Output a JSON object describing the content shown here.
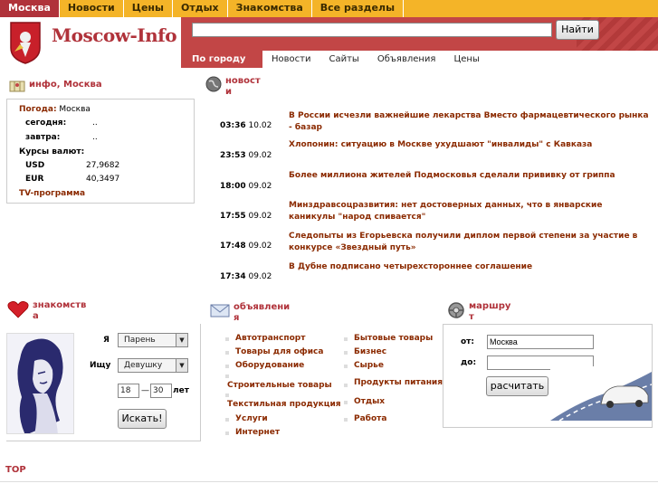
{
  "topnav": [
    "Москва",
    "Новости",
    "Цены",
    "Отдых",
    "Знакомства",
    "Все разделы"
  ],
  "logo": "Moscow-Info",
  "search": {
    "button": "Найти",
    "value": ""
  },
  "subnav": [
    "По городу",
    "Новости",
    "Сайты",
    "Объявления",
    "Цены"
  ],
  "info": {
    "title": "инфо, Москва",
    "weather_label": "Погода:",
    "weather_city": "Москва",
    "today_label": "сегодня:",
    "today_val": "..",
    "tomorrow_label": "завтра:",
    "tomorrow_val": "..",
    "rates_label": "Курсы валют:",
    "usd_label": "USD",
    "usd_val": "27,9682",
    "eur_label": "EUR",
    "eur_val": "40,3497",
    "tv": "TV-программа"
  },
  "news": {
    "title_1": "новост",
    "title_2": "и",
    "items": [
      {
        "time": "03:36",
        "date": "10.02",
        "title": "В России исчезли важнейшие лекарства Вместо фармацевтического рынка - базар"
      },
      {
        "time": "23:53",
        "date": "09.02",
        "title": "Хлопонин: ситуацию в Москве ухудшают \"инвалиды\" с Кавказа"
      },
      {
        "time": "18:00",
        "date": "09.02",
        "title": "Более миллиона жителей Подмосковья сделали прививку от гриппа"
      },
      {
        "time": "17:55",
        "date": "09.02",
        "title": "Минздравсоцразвития: нет достоверных данных, что в январские каникулы \"народ спивается\""
      },
      {
        "time": "17:48",
        "date": "09.02",
        "title": "Следопыты из Егорьевска получили диплом первой степени за участие в конкурсе «Звездный путь»"
      },
      {
        "time": "17:34",
        "date": "09.02",
        "title": "В Дубне подписано четырехстороннее соглашение"
      }
    ]
  },
  "dating": {
    "title_1": "знакомств",
    "title_2": "а",
    "i_label": "Я",
    "i_value": "Парень",
    "seek_label": "Ищу",
    "seek_value": "Девушку",
    "age_from": "18",
    "dash": "—",
    "age_to": "30",
    "years": "лет",
    "search_btn": "Искать!"
  },
  "ads": {
    "title_1": "объявлени",
    "title_2": "я",
    "col1": [
      "Автотранспорт",
      "Товары для офиса",
      "Оборудование",
      "Строительные товары",
      "Текстильная продукция",
      "Услуги",
      "Интернет"
    ],
    "col2": [
      "Бытовые товары",
      "Бизнес",
      "Сырье",
      "Продукты питания",
      "Отдых",
      "Работа"
    ]
  },
  "route": {
    "title_1": "маршру",
    "title_2": "т",
    "from_label": "от:",
    "from_value": "Москва",
    "to_label": "до:",
    "to_value": "",
    "calc_btn": "расчитать"
  },
  "top_label": "TOP"
}
